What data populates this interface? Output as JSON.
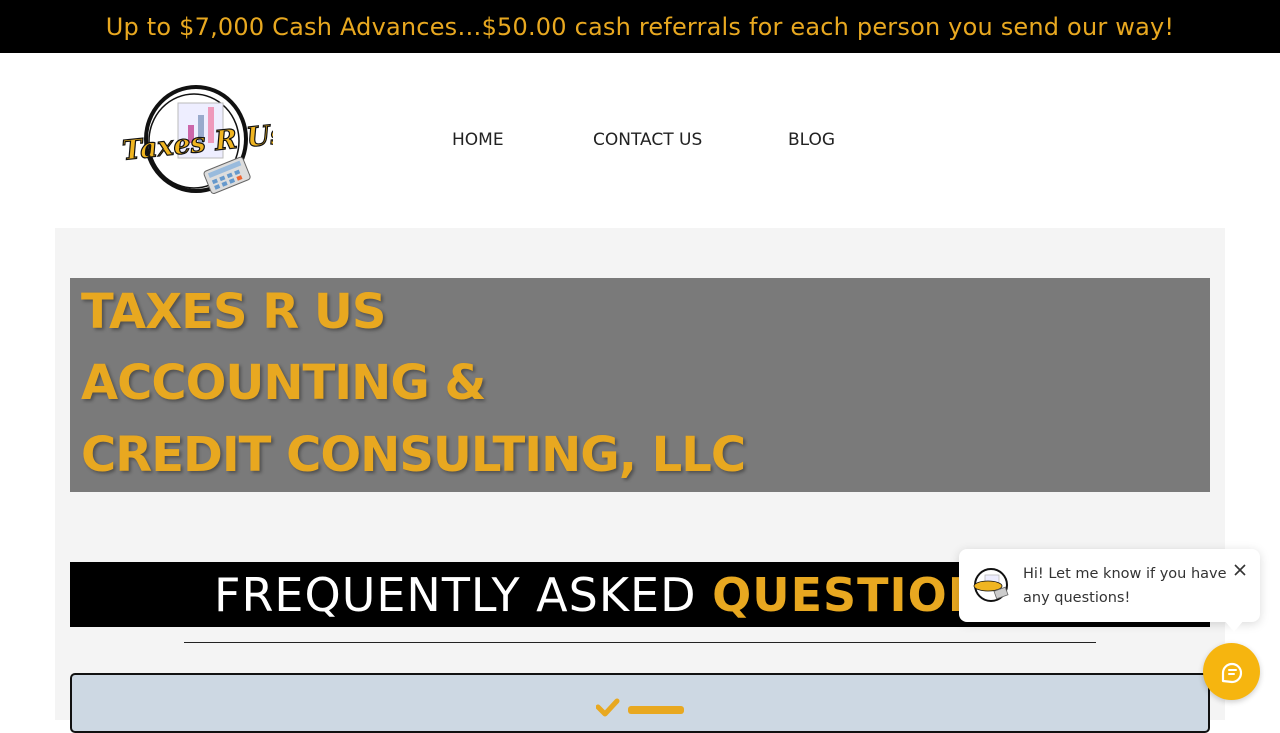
{
  "promo_banner": {
    "text": "Up to $7,000 Cash Advances…$50.00 cash referrals for each person you send our way!"
  },
  "logo": {
    "text": "Taxes R Us",
    "icon": "calculator-chart-logo"
  },
  "nav": {
    "items": [
      {
        "label": "HOME"
      },
      {
        "label": "CONTACT US"
      },
      {
        "label": "BLOG"
      }
    ]
  },
  "hero": {
    "lines": [
      "TAXES R US",
      "ACCOUNTING &",
      "CREDIT CONSULTING, LLC"
    ]
  },
  "faq": {
    "heading_plain": "FREQUENTLY ASKED",
    "heading_accent": "QUESTIONS"
  },
  "card": {
    "icon": "checklist-icon"
  },
  "chat": {
    "message": "Hi! Let me know if you have any questions!",
    "close_icon": "close-icon",
    "launcher_icon": "chat-icon"
  },
  "colors": {
    "accent": "#E8A820",
    "banner_bg": "#000000",
    "hero_bg": "#7a7a7a",
    "card_bg": "#cdd8e3",
    "launcher_bg": "#F6B50F"
  }
}
